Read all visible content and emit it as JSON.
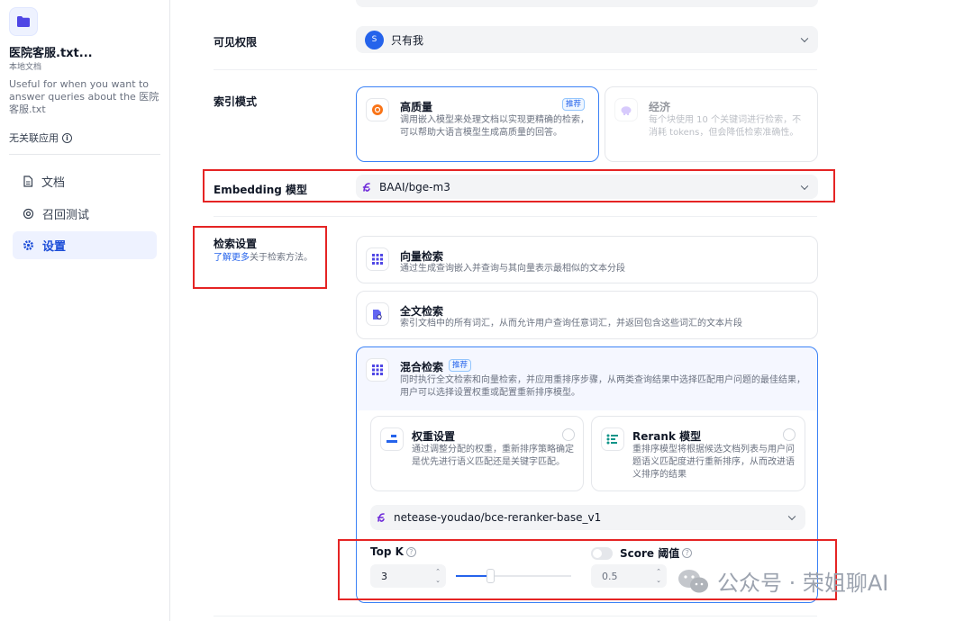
{
  "sidebar": {
    "dataset_name": "医院客服.txt...",
    "dataset_type": "本地文档",
    "description": "Useful for when you want to answer queries about the 医院客服.txt",
    "app_status": "无关联应用",
    "nav": [
      {
        "label": "文档",
        "icon": "document-icon"
      },
      {
        "label": "召回测试",
        "icon": "target-icon"
      },
      {
        "label": "设置",
        "icon": "gear-icon"
      }
    ]
  },
  "permission": {
    "label": "可见权限",
    "avatar_letter": "S",
    "value": "只有我"
  },
  "index_mode": {
    "label": "索引模式",
    "high": {
      "title": "高质量",
      "tag": "推荐",
      "desc": "调用嵌入模型来处理文档以实现更精确的检索，可以帮助大语言模型生成高质量的回答。"
    },
    "economy": {
      "title": "经济",
      "desc": "每个块使用 10 个关键词进行检索，不消耗 tokens，但会降低检索准确性。"
    }
  },
  "embedding": {
    "label": "Embedding 模型",
    "value": "BAAI/bge-m3"
  },
  "retrieval": {
    "label": "检索设置",
    "learn_more_link": "了解更多",
    "learn_more_suffix": "关于检索方法。",
    "vector": {
      "title": "向量检索",
      "desc": "通过生成查询嵌入并查询与其向量表示最相似的文本分段"
    },
    "fulltext": {
      "title": "全文检索",
      "desc": "索引文档中的所有词汇，从而允许用户查询任意词汇，并返回包含这些词汇的文本片段"
    },
    "hybrid": {
      "title": "混合检索",
      "tag": "推荐",
      "desc": "同时执行全文检索和向量检索，并应用重排序步骤，从两类查询结果中选择匹配用户问题的最佳结果，用户可以选择设置权重或配置重新排序模型。",
      "weight": {
        "title": "权重设置",
        "desc": "通过调整分配的权重，重新排序策略确定是优先进行语义匹配还是关键字匹配。"
      },
      "rerank": {
        "title": "Rerank 模型",
        "desc": "重排序模型将根据候选文档列表与用户问题语义匹配度进行重新排序，从而改进语义排序的结果"
      },
      "rerank_model": "netease-youdao/bce-reranker-base_v1",
      "top_k": {
        "label": "Top K",
        "value": "3",
        "slider_fraction": 0.3
      },
      "score": {
        "label": "Score 阈值",
        "value": "0.5",
        "enabled": false
      }
    }
  },
  "watermark": {
    "text": "公众号 · 荣姐聊AI"
  },
  "colors": {
    "accent": "#2563eb",
    "highlight_box": "#e52424"
  }
}
